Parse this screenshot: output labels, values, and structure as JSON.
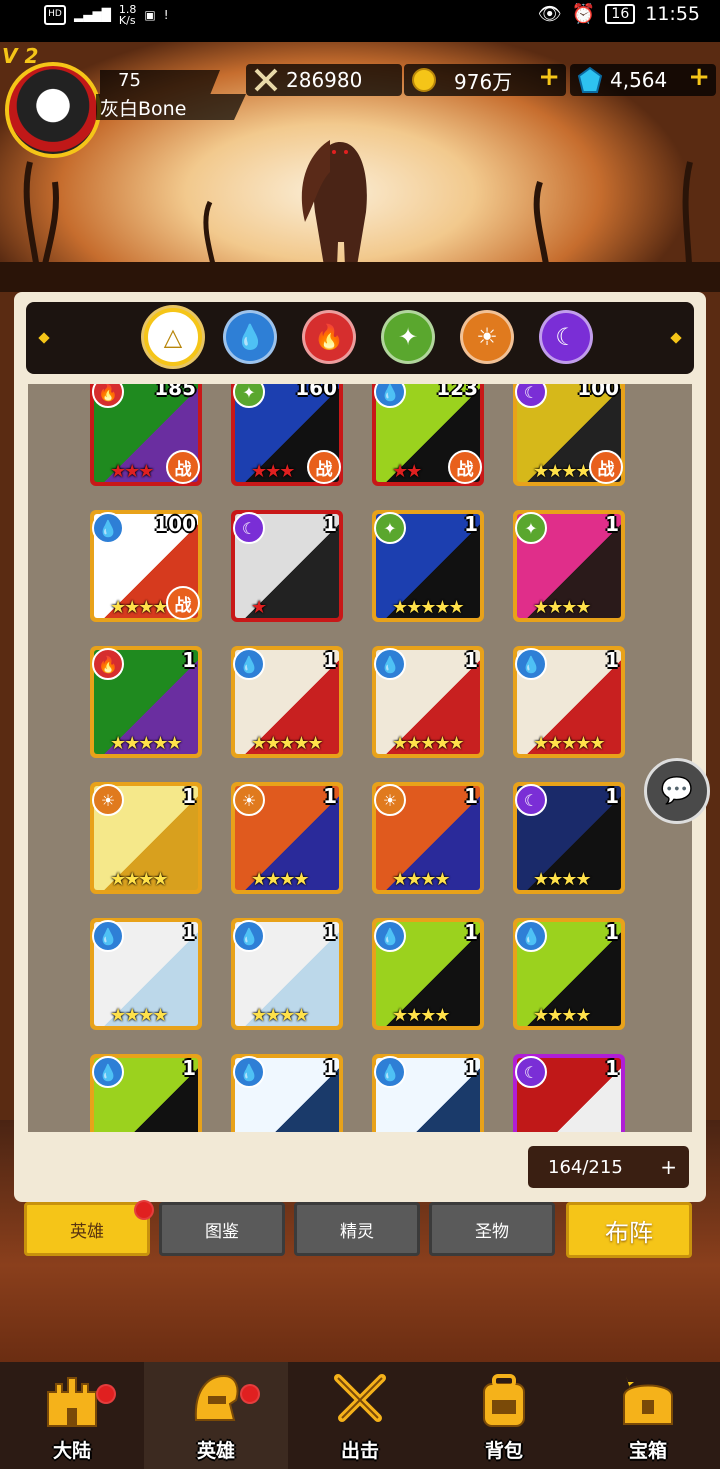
{
  "status_bar": {
    "left_label": "HD",
    "speed": "1.8\nK/s",
    "time": "11:55",
    "battery": "16"
  },
  "player": {
    "vip": "V 2",
    "level": "75",
    "name": "灰白Bone"
  },
  "resources": {
    "power": "286980",
    "gold": "976万",
    "gems": "4,564",
    "plus": "+"
  },
  "elements": [
    {
      "name": "neutral",
      "color": "#ffffff",
      "ring": "#f5c518"
    },
    {
      "name": "water",
      "color": "#2e7fd6"
    },
    {
      "name": "fire",
      "color": "#d62e2e"
    },
    {
      "name": "wind",
      "color": "#5aa72e"
    },
    {
      "name": "light",
      "color": "#e07a1e"
    },
    {
      "name": "dark",
      "color": "#7a2ed6"
    }
  ],
  "heroes": [
    {
      "level": "185",
      "element": "fire",
      "frame": "red",
      "stars": "★★★",
      "stars_color": "red",
      "battle": "战",
      "colors": [
        "#1f8a1f",
        "#6a2ea0"
      ]
    },
    {
      "level": "160",
      "element": "wind",
      "frame": "red",
      "stars": "★★★",
      "stars_color": "red",
      "battle": "战",
      "colors": [
        "#1c3fb0",
        "#111"
      ]
    },
    {
      "level": "123",
      "element": "water",
      "frame": "red",
      "stars": "★★",
      "stars_color": "red",
      "battle": "战",
      "colors": [
        "#9bd21e",
        "#111"
      ]
    },
    {
      "level": "100",
      "element": "dark",
      "frame": "gold",
      "stars": "★★★★★",
      "stars_color": "gold",
      "battle": "战",
      "colors": [
        "#d6b81a",
        "#222"
      ]
    },
    {
      "level": "100",
      "element": "water",
      "frame": "gold",
      "stars": "★★★★",
      "stars_color": "gold",
      "battle": "战",
      "colors": [
        "#fff",
        "#d63a1e"
      ]
    },
    {
      "level": "1",
      "element": "dark",
      "frame": "red",
      "stars": "★",
      "stars_color": "red",
      "battle": "",
      "colors": [
        "#ddd",
        "#222"
      ]
    },
    {
      "level": "1",
      "element": "wind",
      "frame": "gold",
      "stars": "★★★★★",
      "stars_color": "gold",
      "battle": "",
      "colors": [
        "#1c3fb0",
        "#111"
      ]
    },
    {
      "level": "1",
      "element": "wind",
      "frame": "gold",
      "stars": "★★★★",
      "stars_color": "gold",
      "battle": "",
      "colors": [
        "#e02e8a",
        "#2a1a1a"
      ]
    },
    {
      "level": "1",
      "element": "fire",
      "frame": "gold",
      "stars": "★★★★★",
      "stars_color": "gold",
      "battle": "",
      "colors": [
        "#1f8a1f",
        "#6a2ea0"
      ]
    },
    {
      "level": "1",
      "element": "water",
      "frame": "gold",
      "stars": "★★★★★",
      "stars_color": "gold",
      "battle": "",
      "colors": [
        "#f0e8d8",
        "#c82020"
      ]
    },
    {
      "level": "1",
      "element": "water",
      "frame": "gold",
      "stars": "★★★★★",
      "stars_color": "gold",
      "battle": "",
      "colors": [
        "#f0e8d8",
        "#c82020"
      ]
    },
    {
      "level": "1",
      "element": "water",
      "frame": "gold",
      "stars": "★★★★★",
      "stars_color": "gold",
      "battle": "",
      "colors": [
        "#f0e8d8",
        "#c82020"
      ]
    },
    {
      "level": "1",
      "element": "light",
      "frame": "gold",
      "stars": "★★★★",
      "stars_color": "gold",
      "battle": "",
      "colors": [
        "#f5e88a",
        "#d8a01e"
      ]
    },
    {
      "level": "1",
      "element": "light",
      "frame": "gold",
      "stars": "★★★★",
      "stars_color": "gold",
      "battle": "",
      "colors": [
        "#e05a1e",
        "#2a2a9a"
      ]
    },
    {
      "level": "1",
      "element": "light",
      "frame": "gold",
      "stars": "★★★★",
      "stars_color": "gold",
      "battle": "",
      "colors": [
        "#e05a1e",
        "#2a2a9a"
      ]
    },
    {
      "level": "1",
      "element": "dark",
      "frame": "gold",
      "stars": "★★★★",
      "stars_color": "gold",
      "battle": "",
      "colors": [
        "#1a2a6a",
        "#111"
      ]
    },
    {
      "level": "1",
      "element": "water",
      "frame": "gold",
      "stars": "★★★★",
      "stars_color": "gold",
      "battle": "",
      "colors": [
        "#f0f0f0",
        "#bcd8ea"
      ]
    },
    {
      "level": "1",
      "element": "water",
      "frame": "gold",
      "stars": "★★★★",
      "stars_color": "gold",
      "battle": "",
      "colors": [
        "#f0f0f0",
        "#bcd8ea"
      ]
    },
    {
      "level": "1",
      "element": "water",
      "frame": "gold",
      "stars": "★★★★",
      "stars_color": "gold",
      "battle": "",
      "colors": [
        "#9bd21e",
        "#111"
      ]
    },
    {
      "level": "1",
      "element": "water",
      "frame": "gold",
      "stars": "★★★★",
      "stars_color": "gold",
      "battle": "",
      "colors": [
        "#9bd21e",
        "#111"
      ]
    },
    {
      "level": "1",
      "element": "water",
      "frame": "gold",
      "stars": "",
      "stars_color": "gold",
      "battle": "",
      "colors": [
        "#9bd21e",
        "#111"
      ]
    },
    {
      "level": "1",
      "element": "water",
      "frame": "gold",
      "stars": "",
      "stars_color": "gold",
      "battle": "",
      "colors": [
        "#f0f8ff",
        "#1a3a6a"
      ]
    },
    {
      "level": "1",
      "element": "water",
      "frame": "gold",
      "stars": "",
      "stars_color": "gold",
      "battle": "",
      "colors": [
        "#f0f8ff",
        "#1a3a6a"
      ]
    },
    {
      "level": "1",
      "element": "dark",
      "frame": "purple",
      "stars": "",
      "stars_color": "gold",
      "battle": "",
      "colors": [
        "#c01818",
        "#eee"
      ]
    }
  ],
  "hero_count": "164/215",
  "count_plus": "+",
  "sub_tabs": [
    "英雄",
    "图鉴",
    "精灵",
    "圣物"
  ],
  "formation_button": "布阵",
  "bottom_nav": [
    "大陆",
    "英雄",
    "出击",
    "背包",
    "宝箱"
  ],
  "colors": {
    "accent": "#f5c518",
    "panel": "#f2e9d6",
    "grid_bg": "#8e8170",
    "nav_bg": "#2c1b14"
  }
}
